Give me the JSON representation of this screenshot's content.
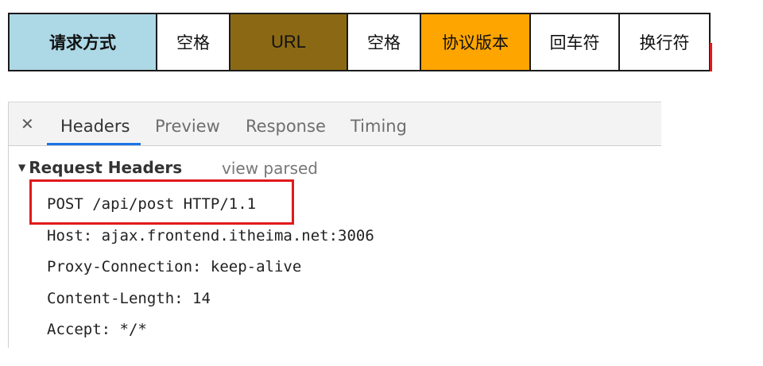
{
  "diagram": {
    "segments": [
      "请求方式",
      "空格",
      "URL",
      "空格",
      "协议版本",
      "回车符",
      "换行符"
    ]
  },
  "devtools": {
    "tabs": [
      "Headers",
      "Preview",
      "Response",
      "Timing"
    ],
    "active_tab": "Headers",
    "section_title": "Request Headers",
    "view_parsed": "view parsed",
    "request_line": "POST /api/post HTTP/1.1",
    "headers": [
      "Host: ajax.frontend.itheima.net:3006",
      "Proxy-Connection: keep-alive",
      "Content-Length: 14",
      "Accept: */*"
    ]
  }
}
